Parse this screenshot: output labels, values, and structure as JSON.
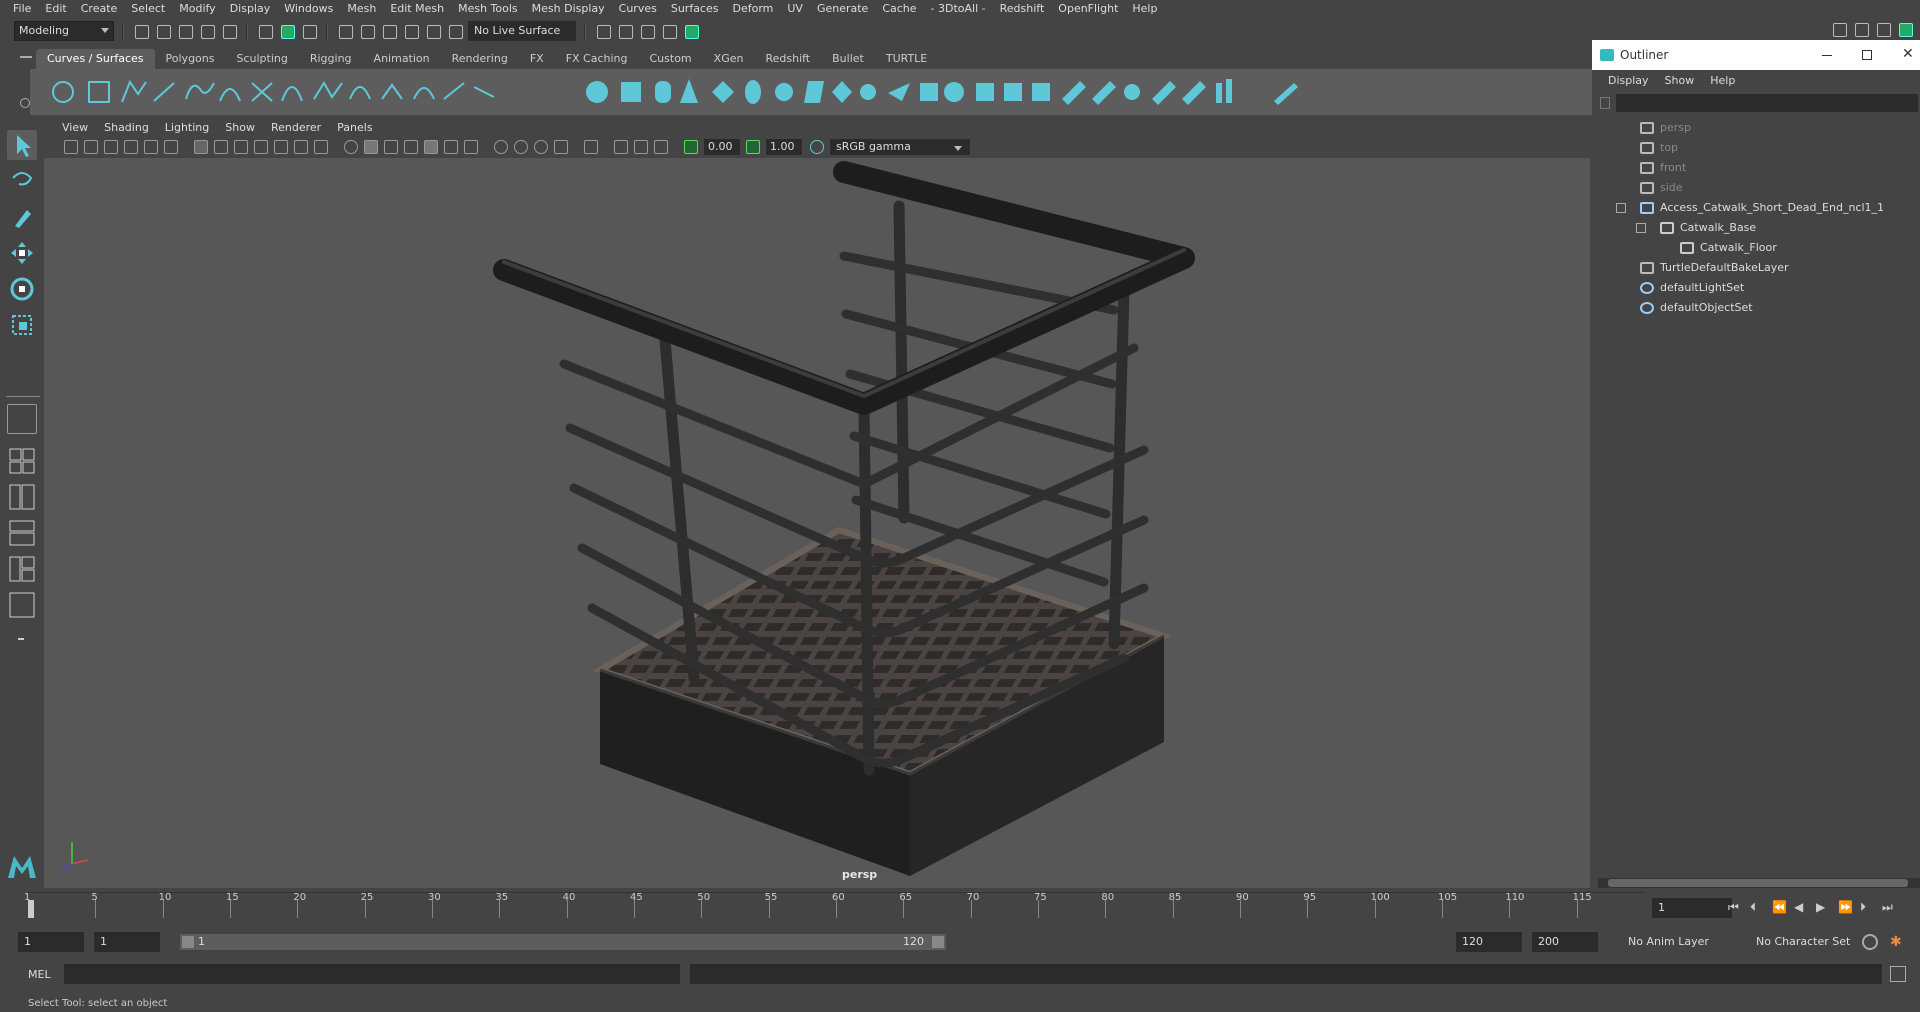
{
  "menubar": [
    "File",
    "Edit",
    "Create",
    "Select",
    "Modify",
    "Display",
    "Windows",
    "Mesh",
    "Edit Mesh",
    "Mesh Tools",
    "Mesh Display",
    "Curves",
    "Surfaces",
    "Deform",
    "UV",
    "Generate",
    "Cache",
    "- 3DtoAll -",
    "Redshift",
    "OpenFlight",
    "Help"
  ],
  "statusline": {
    "mode": "Modeling",
    "live_surface": "No Live Surface"
  },
  "shelf_tabs": [
    "Curves / Surfaces",
    "Polygons",
    "Sculpting",
    "Rigging",
    "Animation",
    "Rendering",
    "FX",
    "FX Caching",
    "Custom",
    "XGen",
    "Redshift",
    "Bullet",
    "TURTLE"
  ],
  "shelf_active": "Curves / Surfaces",
  "panel_menu": [
    "View",
    "Shading",
    "Lighting",
    "Show",
    "Renderer",
    "Panels"
  ],
  "panel_bar": {
    "exposure": "0.00",
    "gamma": "1.00",
    "colorspace": "sRGB gamma"
  },
  "viewport": {
    "camera": "persp"
  },
  "outliner": {
    "title": "Outliner",
    "menu": [
      "Display",
      "Show",
      "Help"
    ],
    "items": [
      {
        "label": "persp",
        "kind": "camera",
        "indent": 0
      },
      {
        "label": "top",
        "kind": "camera",
        "indent": 0
      },
      {
        "label": "front",
        "kind": "camera",
        "indent": 0
      },
      {
        "label": "side",
        "kind": "camera",
        "indent": 0
      },
      {
        "label": "Access_Catwalk_Short_Dead_End_ncl1_1",
        "kind": "group",
        "indent": 0
      },
      {
        "label": "Catwalk_Base",
        "kind": "mesh",
        "indent": 1
      },
      {
        "label": "Catwalk_Floor",
        "kind": "mesh",
        "indent": 2
      },
      {
        "label": "TurtleDefaultBakeLayer",
        "kind": "node",
        "indent": 0
      },
      {
        "label": "defaultLightSet",
        "kind": "set",
        "indent": 0
      },
      {
        "label": "defaultObjectSet",
        "kind": "set",
        "indent": 0
      }
    ]
  },
  "timeline": {
    "ticks": [
      "1",
      "5",
      "10",
      "15",
      "20",
      "25",
      "30",
      "35",
      "40",
      "45",
      "50",
      "55",
      "60",
      "65",
      "70",
      "75",
      "80",
      "85",
      "90",
      "95",
      "100",
      "105",
      "110",
      "115"
    ],
    "current_frame": "1"
  },
  "range": {
    "start": "1",
    "anim_start": "1",
    "range_lo": "1",
    "range_hi": "120",
    "end": "120",
    "anim_end": "200",
    "anim_layer": "No Anim Layer",
    "character_set": "No Character Set"
  },
  "cmdline": {
    "lang": "MEL"
  },
  "helpline": "Select Tool: select an object",
  "colors": {
    "accent": "#5fc8d8",
    "panel": "#444444",
    "viewport_bg": "#575757"
  }
}
